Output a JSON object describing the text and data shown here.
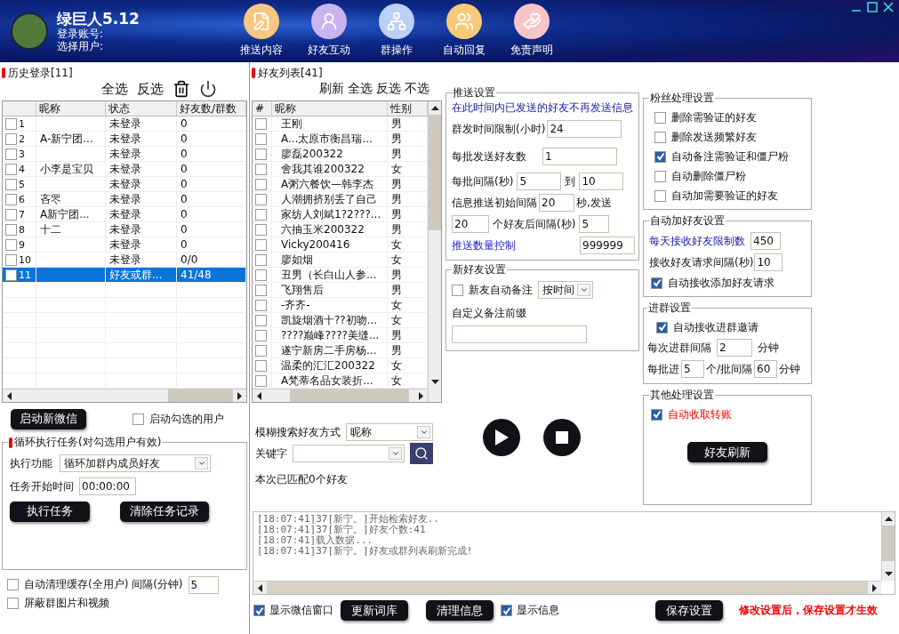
{
  "window": {
    "title": "绿巨人5.12",
    "account_label": "登录账号:",
    "user_label": "选择用户:"
  },
  "nav": [
    {
      "kind": "pen",
      "label": "推送内容"
    },
    {
      "kind": "person",
      "label": "好友互动"
    },
    {
      "kind": "network",
      "label": "群操作"
    },
    {
      "kind": "people",
      "label": "自动回复"
    },
    {
      "kind": "hand",
      "label": "免责声明"
    }
  ],
  "history": {
    "title": "历史登录[11]",
    "actions": [
      "全选",
      "反选"
    ],
    "columns": [
      "昵称",
      "状态",
      "好友数/群数"
    ],
    "rows": [
      {
        "index": "1",
        "status": "未登录",
        "count": "0",
        "checked": false,
        "selected": false
      },
      {
        "index": "2",
        "nickname": "A-新宁团...",
        "status": "未登录",
        "count": "0",
        "checked": false,
        "selected": false
      },
      {
        "index": "3",
        "status": "未登录",
        "count": "0",
        "checked": false,
        "selected": false
      },
      {
        "index": "4",
        "nickname": "小李是宝贝",
        "status": "未登录",
        "count": "0",
        "checked": false,
        "selected": false
      },
      {
        "index": "5",
        "status": "未登录",
        "count": "0",
        "checked": false,
        "selected": false
      },
      {
        "index": "6",
        "nickname": "吝罖",
        "status": "未登录",
        "count": "0",
        "checked": false,
        "selected": false
      },
      {
        "index": "7",
        "nickname": "A新宁团...",
        "status": "未登录",
        "count": "0",
        "checked": false,
        "selected": false
      },
      {
        "index": "8",
        "nickname": "十二",
        "status": "未登录",
        "count": "0",
        "checked": false,
        "selected": false
      },
      {
        "index": "9",
        "status": "未登录",
        "count": "0",
        "checked": false,
        "selected": false
      },
      {
        "index": "10",
        "status": "未登录",
        "count": "0/0",
        "checked": false,
        "selected": false
      },
      {
        "index": "11",
        "status": "好友或群...",
        "count": "41/48",
        "checked": false,
        "selected": true
      }
    ]
  },
  "launch": {
    "button": "启动新微信",
    "option": {
      "label": "启动勾选的用户",
      "checked": false
    }
  },
  "loop_task": {
    "title": "循环执行任务(对勾选用户有效)",
    "function_label": "执行功能",
    "function_value": "循环加群内成员好友",
    "start_label": "任务开始时间",
    "start_value": "00:00:00",
    "buttons": [
      "执行任务",
      "清除任务记录"
    ]
  },
  "options": [
    {
      "label": "自动清理缓存(全用户) 间隔(分钟)",
      "checked": false,
      "value": "5"
    },
    {
      "label": "屏蔽群图片和视频",
      "checked": false
    }
  ],
  "friends": {
    "title": "好友列表[41]",
    "actions": [
      "刷新",
      "全选",
      "反选",
      "不选"
    ],
    "columns": [
      "#",
      "昵称",
      "性别"
    ],
    "rows": [
      {
        "nickname": "王刚",
        "gender": "男",
        "checked": false
      },
      {
        "nickname": "A...太原市衡昌瑞...",
        "gender": "男",
        "checked": false
      },
      {
        "nickname": "廖磊200322",
        "gender": "男",
        "checked": false
      },
      {
        "nickname": "舍我其谁200322",
        "gender": "女",
        "checked": false
      },
      {
        "nickname": "A粥六餐饮—韩李杰",
        "gender": "男",
        "checked": false
      },
      {
        "nickname": "人潮拥挤别丢了自己",
        "gender": "男",
        "checked": false
      },
      {
        "nickname": "家纺人刘斌1?2???...",
        "gender": "男",
        "checked": false
      },
      {
        "nickname": "六抽玉米200322",
        "gender": "男",
        "checked": false
      },
      {
        "nickname": "Vicky200416",
        "gender": "女",
        "checked": false
      },
      {
        "nickname": "廖如烟",
        "gender": "女",
        "checked": false
      },
      {
        "nickname": "丑男（长白山人参...",
        "gender": "男",
        "checked": false
      },
      {
        "nickname": "飞翔售后",
        "gender": "男",
        "checked": false
      },
      {
        "nickname": "-齐齐-",
        "gender": "女",
        "checked": false
      },
      {
        "nickname": "凯旋烟酒十??初吻...",
        "gender": "女",
        "checked": false
      },
      {
        "nickname": "????巅峰????美缝...",
        "gender": "男",
        "checked": false
      },
      {
        "nickname": "遂宁新房二手房杨...",
        "gender": "男",
        "checked": false
      },
      {
        "nickname": "温柔的汇汇200322",
        "gender": "女",
        "checked": false
      },
      {
        "nickname": "A梵蒂名品女装折...",
        "gender": "女",
        "checked": false
      }
    ]
  },
  "search": {
    "mode_label": "模糊搜索好友方式",
    "mode_value": "昵称",
    "keyword_label": "关键字",
    "result": "本次已匹配0个好友"
  },
  "push_settings": {
    "title": "推送设置",
    "note": "在此时间内已发送的好友不再发送信息",
    "limit_label": "群发时间限制(小时)",
    "limit_value": "24",
    "batch_label": "每批发送好友数",
    "batch_value": "1",
    "interval_label": "每批间隔(秒)",
    "interval_from": "5",
    "to_label": "到",
    "interval_to": "10",
    "initial_label": "信息推送初始间隔",
    "initial_value": "20",
    "initial_suffix": "秒,发送",
    "after_value": "20",
    "after_label": "个好友后间隔(秒)",
    "after_interval": "5",
    "quantity_label": "推送数量控制",
    "quantity_value": "999999"
  },
  "new_friend": {
    "title": "新好友设置",
    "auto_remark": {
      "label": "新友自动备注",
      "checked": false
    },
    "remark_mode": "按时间",
    "prefix_label": "自定义备注前缀"
  },
  "fan_settings": {
    "title": "粉丝处理设置",
    "options": [
      {
        "label": "删除需验证的好友",
        "checked": false
      },
      {
        "label": "删除发送频繁好友",
        "checked": false
      },
      {
        "label": "自动备注需验证和僵尸粉",
        "checked": true
      },
      {
        "label": "自动删除僵尸粉",
        "checked": false
      },
      {
        "label": "自动加需要验证的好友",
        "checked": false
      }
    ]
  },
  "auto_add": {
    "title": "自动加好友设置",
    "daily_label": "每天接收好友限制数",
    "daily_value": "450",
    "interval_label": "接收好友请求间隔(秒)",
    "interval_value": "10",
    "accept": {
      "label": "自动接收添加好友请求",
      "checked": true
    }
  },
  "group_join": {
    "title": "进群设置",
    "accept": {
      "label": "自动接收进群邀请",
      "checked": true
    },
    "interval_label": "每次进群间隔",
    "interval_value": "2",
    "interval_unit": "分钟",
    "batch_label": "每批进",
    "batch_value": "5",
    "batch_unit": "个/批间隔",
    "batch_interval": "60",
    "batch_interval_unit": "分钟"
  },
  "other": {
    "title": "其他处理设置",
    "transfer": {
      "label": "自动收取转账",
      "checked": true
    },
    "button": "好友刷新"
  },
  "log": [
    "[18:07:41]37[新宁。]开始检索好友..",
    "[18:07:41]37[新宁。]好友个数:41",
    "[18:07:41]载入数据...",
    "[18:07:41]37[新宁。]好友或群列表刷新完成!"
  ],
  "footer": {
    "show_wechat": {
      "label": "显示微信窗口",
      "checked": true
    },
    "update_button": "更新词库",
    "clear_button": "清理信息",
    "show_info": {
      "label": "显示信息",
      "checked": true
    },
    "save_button": "保存设置",
    "notice": "修改设置后，保存设置才生效"
  }
}
